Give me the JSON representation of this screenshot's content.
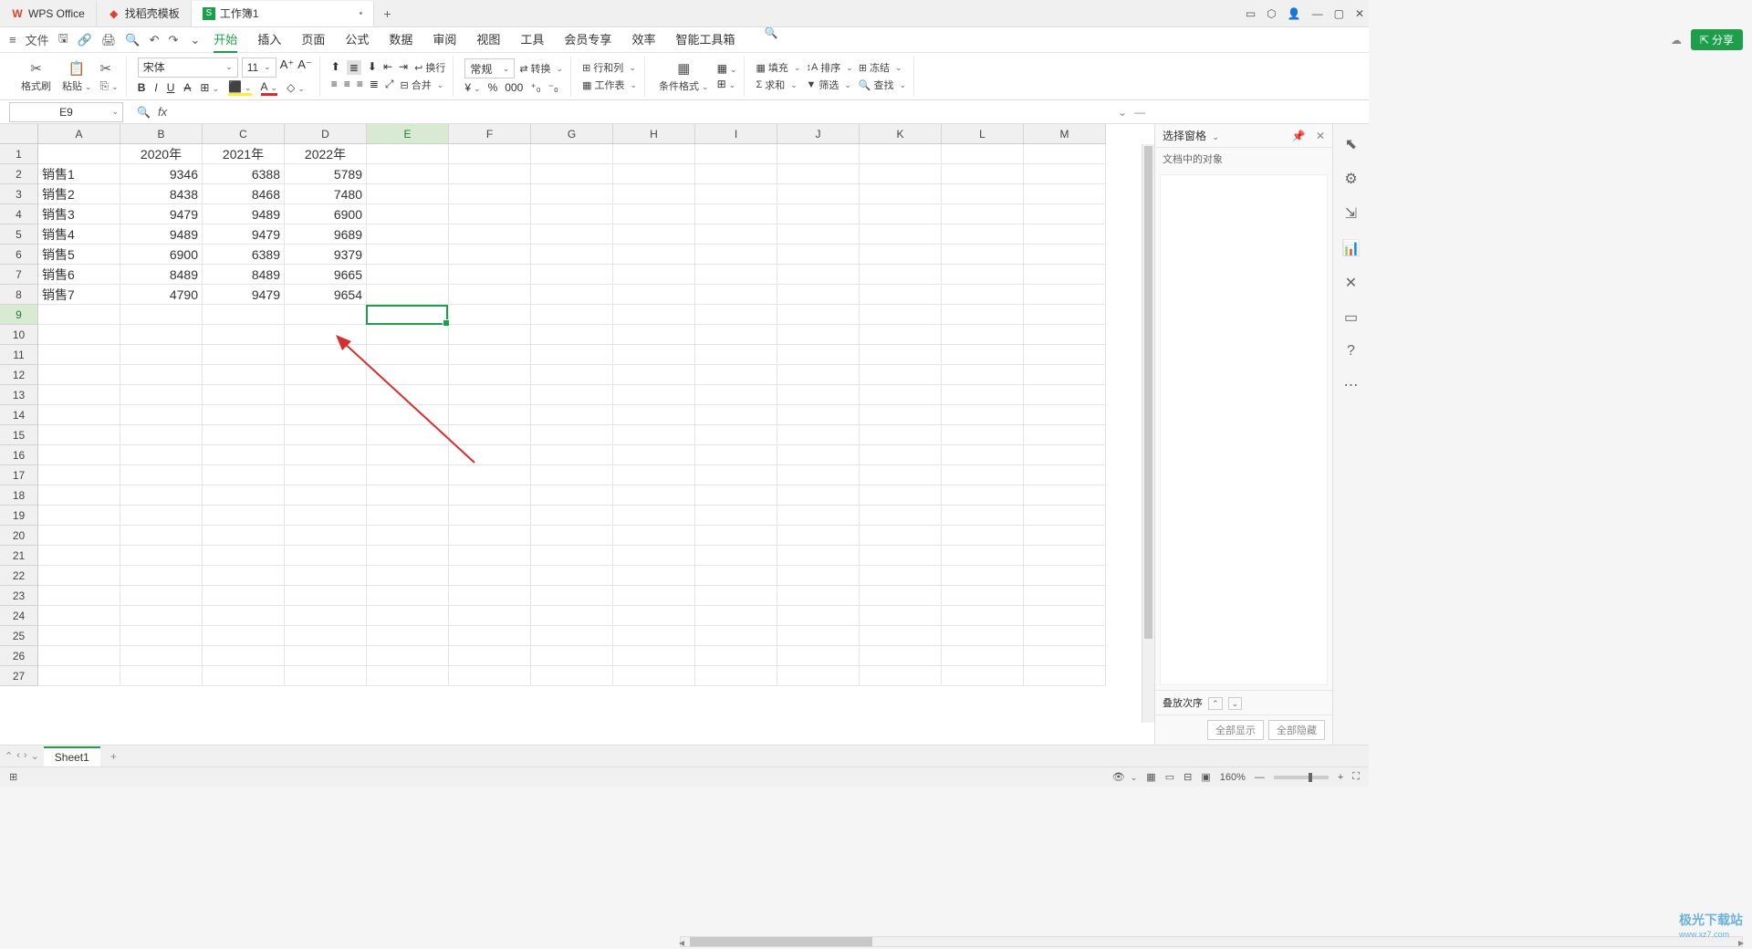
{
  "titlebar": {
    "app_name": "WPS Office",
    "tab_template": "找稻壳模板",
    "tab_workbook": "工作簿1"
  },
  "menubar": {
    "file": "文件",
    "tabs": [
      "开始",
      "插入",
      "页面",
      "公式",
      "数据",
      "审阅",
      "视图",
      "工具",
      "会员专享",
      "效率",
      "智能工具箱"
    ],
    "active": "开始",
    "share": "分享"
  },
  "ribbon": {
    "format_brush": "格式刷",
    "paste": "粘贴",
    "font_name": "宋体",
    "font_size": "11",
    "wrap": "换行",
    "merge": "合并",
    "general": "常规",
    "conv": "转换",
    "rowcol": "行和列",
    "worksheet": "工作表",
    "cond_fmt": "条件格式",
    "fill": "填充",
    "sort": "排序",
    "freeze": "冻结",
    "sum": "求和",
    "filter": "筛选",
    "find": "查找"
  },
  "formula_bar": {
    "cell_ref": "E9"
  },
  "side_panel": {
    "title": "选择窗格",
    "doc_objects": "文档中的对象",
    "stack_order": "叠放次序",
    "show_all": "全部显示",
    "hide_all": "全部隐藏"
  },
  "sheet": {
    "cols": [
      "A",
      "B",
      "C",
      "D",
      "E",
      "F",
      "G",
      "H",
      "I",
      "J",
      "K",
      "L",
      "M"
    ],
    "active_col": "E",
    "active_row": 9,
    "headers": {
      "b1": "2020年",
      "c1": "2021年",
      "d1": "2022年"
    },
    "rows": [
      {
        "a": "销售1",
        "b": "9346",
        "c": "6388",
        "d": "5789"
      },
      {
        "a": "销售2",
        "b": "8438",
        "c": "8468",
        "d": "7480"
      },
      {
        "a": "销售3",
        "b": "9479",
        "c": "9489",
        "d": "6900"
      },
      {
        "a": "销售4",
        "b": "9489",
        "c": "9479",
        "d": "9689"
      },
      {
        "a": "销售5",
        "b": "6900",
        "c": "6389",
        "d": "9379"
      },
      {
        "a": "销售6",
        "b": "8489",
        "c": "8489",
        "d": "9665"
      },
      {
        "a": "销售7",
        "b": "4790",
        "c": "9479",
        "d": "9654"
      }
    ]
  },
  "sheettabs": {
    "sheet1": "Sheet1"
  },
  "status": {
    "zoom": "160%"
  },
  "watermark": {
    "main": "极光下载站",
    "sub": "www.xz7.com"
  }
}
